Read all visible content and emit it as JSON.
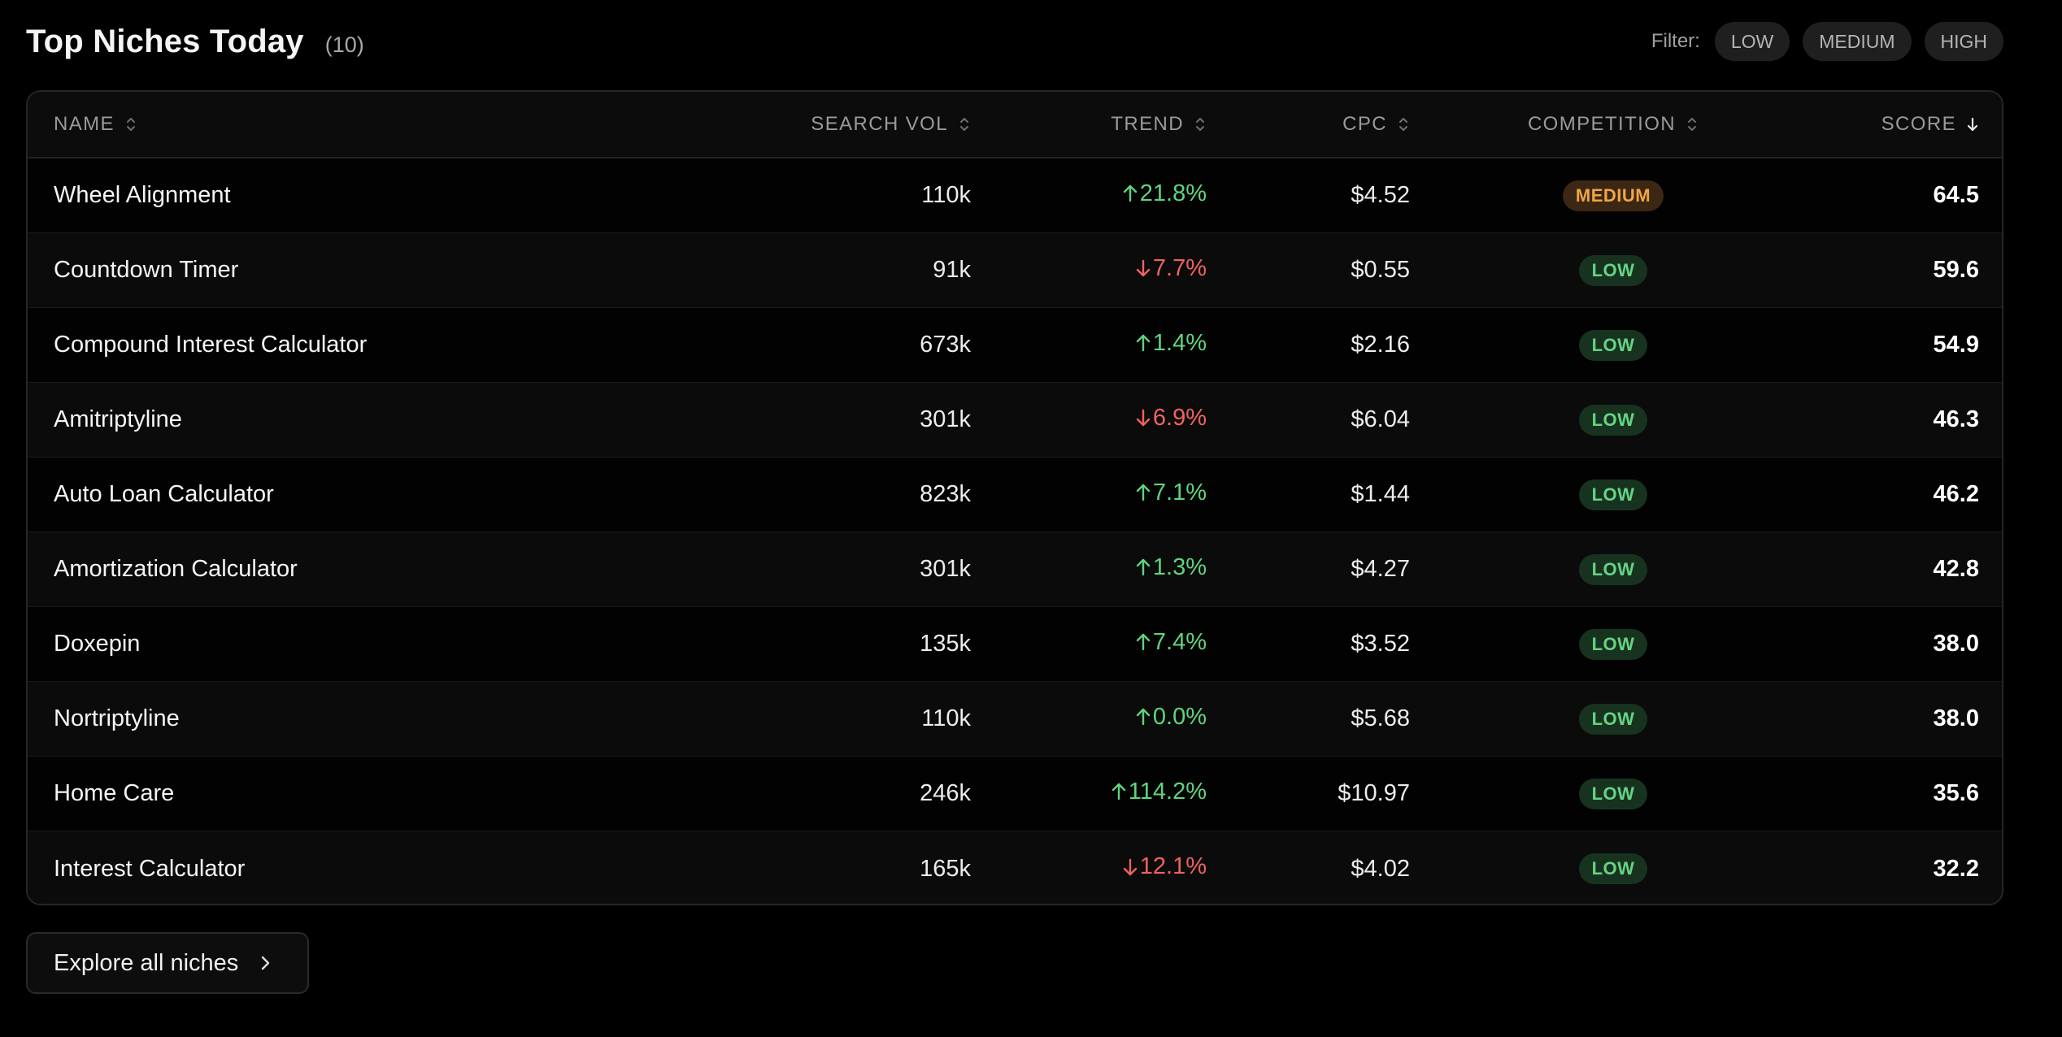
{
  "header": {
    "title": "Top Niches Today",
    "count": "(10)",
    "filter_label": "Filter:",
    "filters": [
      "LOW",
      "MEDIUM",
      "HIGH"
    ]
  },
  "table": {
    "columns": {
      "name": "NAME",
      "search_vol": "SEARCH VOL",
      "trend": "TREND",
      "cpc": "CPC",
      "competition": "COMPETITION",
      "score": "SCORE"
    },
    "sorted_by": "score",
    "sort_direction": "descending",
    "rows": [
      {
        "name": "Wheel Alignment",
        "search_vol": "110k",
        "trend": "21.8%",
        "trend_dir": "up",
        "cpc": "$4.52",
        "competition": "MEDIUM",
        "score": "64.5"
      },
      {
        "name": "Countdown Timer",
        "search_vol": "91k",
        "trend": "7.7%",
        "trend_dir": "down",
        "cpc": "$0.55",
        "competition": "LOW",
        "score": "59.6"
      },
      {
        "name": "Compound Interest Calculator",
        "search_vol": "673k",
        "trend": "1.4%",
        "trend_dir": "up",
        "cpc": "$2.16",
        "competition": "LOW",
        "score": "54.9"
      },
      {
        "name": "Amitriptyline",
        "search_vol": "301k",
        "trend": "6.9%",
        "trend_dir": "down",
        "cpc": "$6.04",
        "competition": "LOW",
        "score": "46.3"
      },
      {
        "name": "Auto Loan Calculator",
        "search_vol": "823k",
        "trend": "7.1%",
        "trend_dir": "up",
        "cpc": "$1.44",
        "competition": "LOW",
        "score": "46.2"
      },
      {
        "name": "Amortization Calculator",
        "search_vol": "301k",
        "trend": "1.3%",
        "trend_dir": "up",
        "cpc": "$4.27",
        "competition": "LOW",
        "score": "42.8"
      },
      {
        "name": "Doxepin",
        "search_vol": "135k",
        "trend": "7.4%",
        "trend_dir": "up",
        "cpc": "$3.52",
        "competition": "LOW",
        "score": "38.0"
      },
      {
        "name": "Nortriptyline",
        "search_vol": "110k",
        "trend": "0.0%",
        "trend_dir": "up",
        "cpc": "$5.68",
        "competition": "LOW",
        "score": "38.0"
      },
      {
        "name": "Home Care",
        "search_vol": "246k",
        "trend": "114.2%",
        "trend_dir": "up",
        "cpc": "$10.97",
        "competition": "LOW",
        "score": "35.6"
      },
      {
        "name": "Interest Calculator",
        "search_vol": "165k",
        "trend": "12.1%",
        "trend_dir": "down",
        "cpc": "$4.02",
        "competition": "LOW",
        "score": "32.2"
      }
    ]
  },
  "footer": {
    "explore_label": "Explore all niches"
  },
  "colors": {
    "background": "#000000",
    "trend_up": "#5fd47f",
    "trend_down": "#f06262",
    "badge_low_bg": "#17331f",
    "badge_low_text": "#66d384",
    "badge_medium_bg": "#3b2713",
    "badge_medium_text": "#f0a547"
  }
}
